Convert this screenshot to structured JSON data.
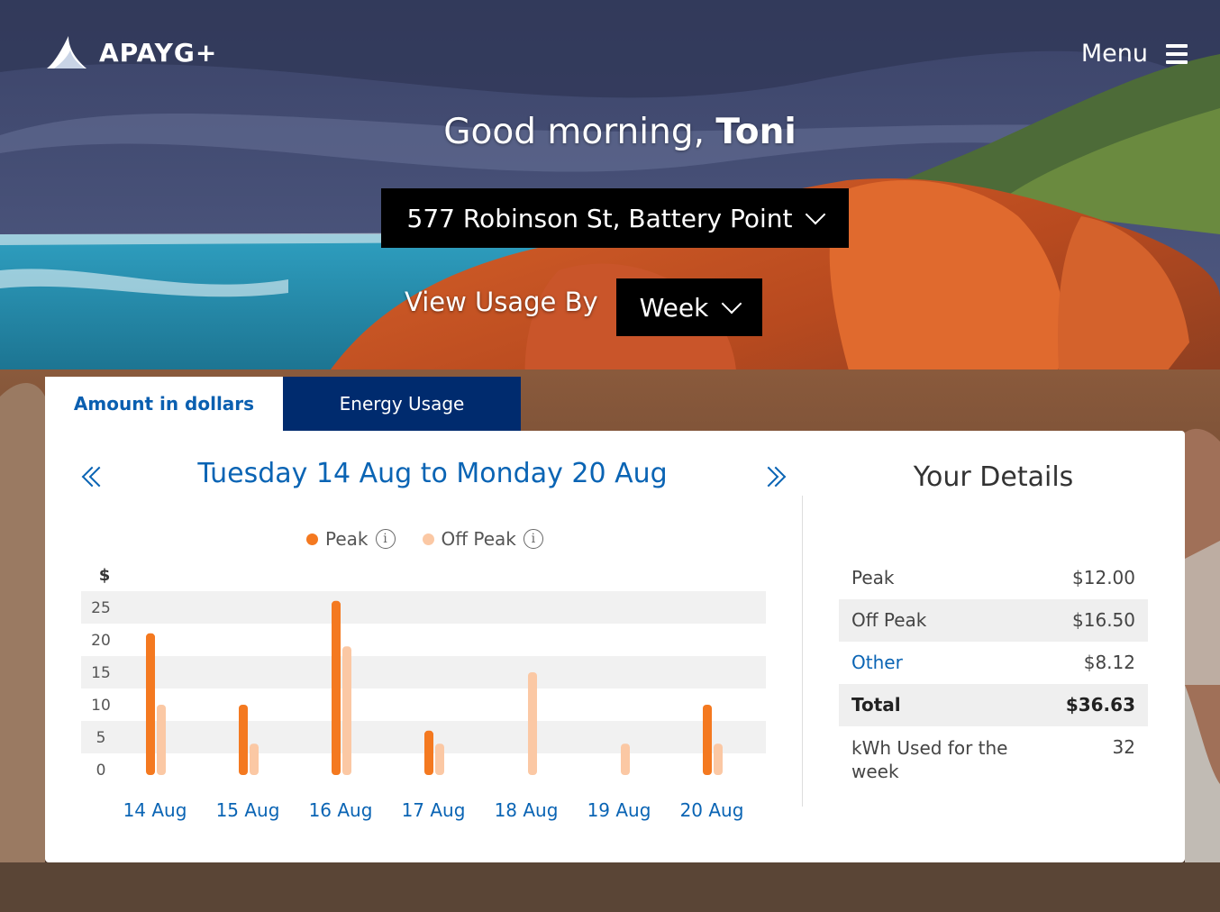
{
  "brand": {
    "name": "APAYG+"
  },
  "header": {
    "menu_label": "Menu"
  },
  "greeting": {
    "prefix": "Good morning, ",
    "name": "Toni"
  },
  "address": {
    "selected": "577 Robinson St, Battery Point"
  },
  "view_usage": {
    "label": "View Usage By",
    "selected": "Week"
  },
  "tabs": [
    {
      "label": "Amount in dollars",
      "active": true
    },
    {
      "label": "Energy Usage",
      "active": false
    }
  ],
  "period": {
    "title": "Tuesday 14 Aug to Monday 20 Aug"
  },
  "legend": {
    "peak": "Peak",
    "off_peak": "Off Peak"
  },
  "colors": {
    "peak": "#f47920",
    "off_peak": "#fbc8a4",
    "accent": "#0a64b4",
    "tab_dark": "#002b6e"
  },
  "chart_data": {
    "type": "bar",
    "ylabel": "$",
    "yticks": [
      0,
      5,
      10,
      15,
      20,
      25
    ],
    "ylim": [
      0,
      25
    ],
    "categories": [
      "14 Aug",
      "15 Aug",
      "16 Aug",
      "17 Aug",
      "18 Aug",
      "19 Aug",
      "20 Aug"
    ],
    "series": [
      {
        "name": "Peak",
        "values": [
          21,
          10,
          26,
          6,
          0,
          0,
          10
        ]
      },
      {
        "name": "Off Peak",
        "values": [
          10,
          4,
          19,
          4,
          15,
          4,
          4
        ]
      }
    ]
  },
  "details": {
    "title": "Your Details",
    "rows": [
      {
        "label": "Peak",
        "value": "$12.00"
      },
      {
        "label": "Off Peak",
        "value": "$16.50"
      },
      {
        "label": "Other",
        "value": "$8.12"
      },
      {
        "label": "Total",
        "value": "$36.63"
      },
      {
        "label": "kWh Used for the week",
        "value": "32"
      }
    ]
  }
}
